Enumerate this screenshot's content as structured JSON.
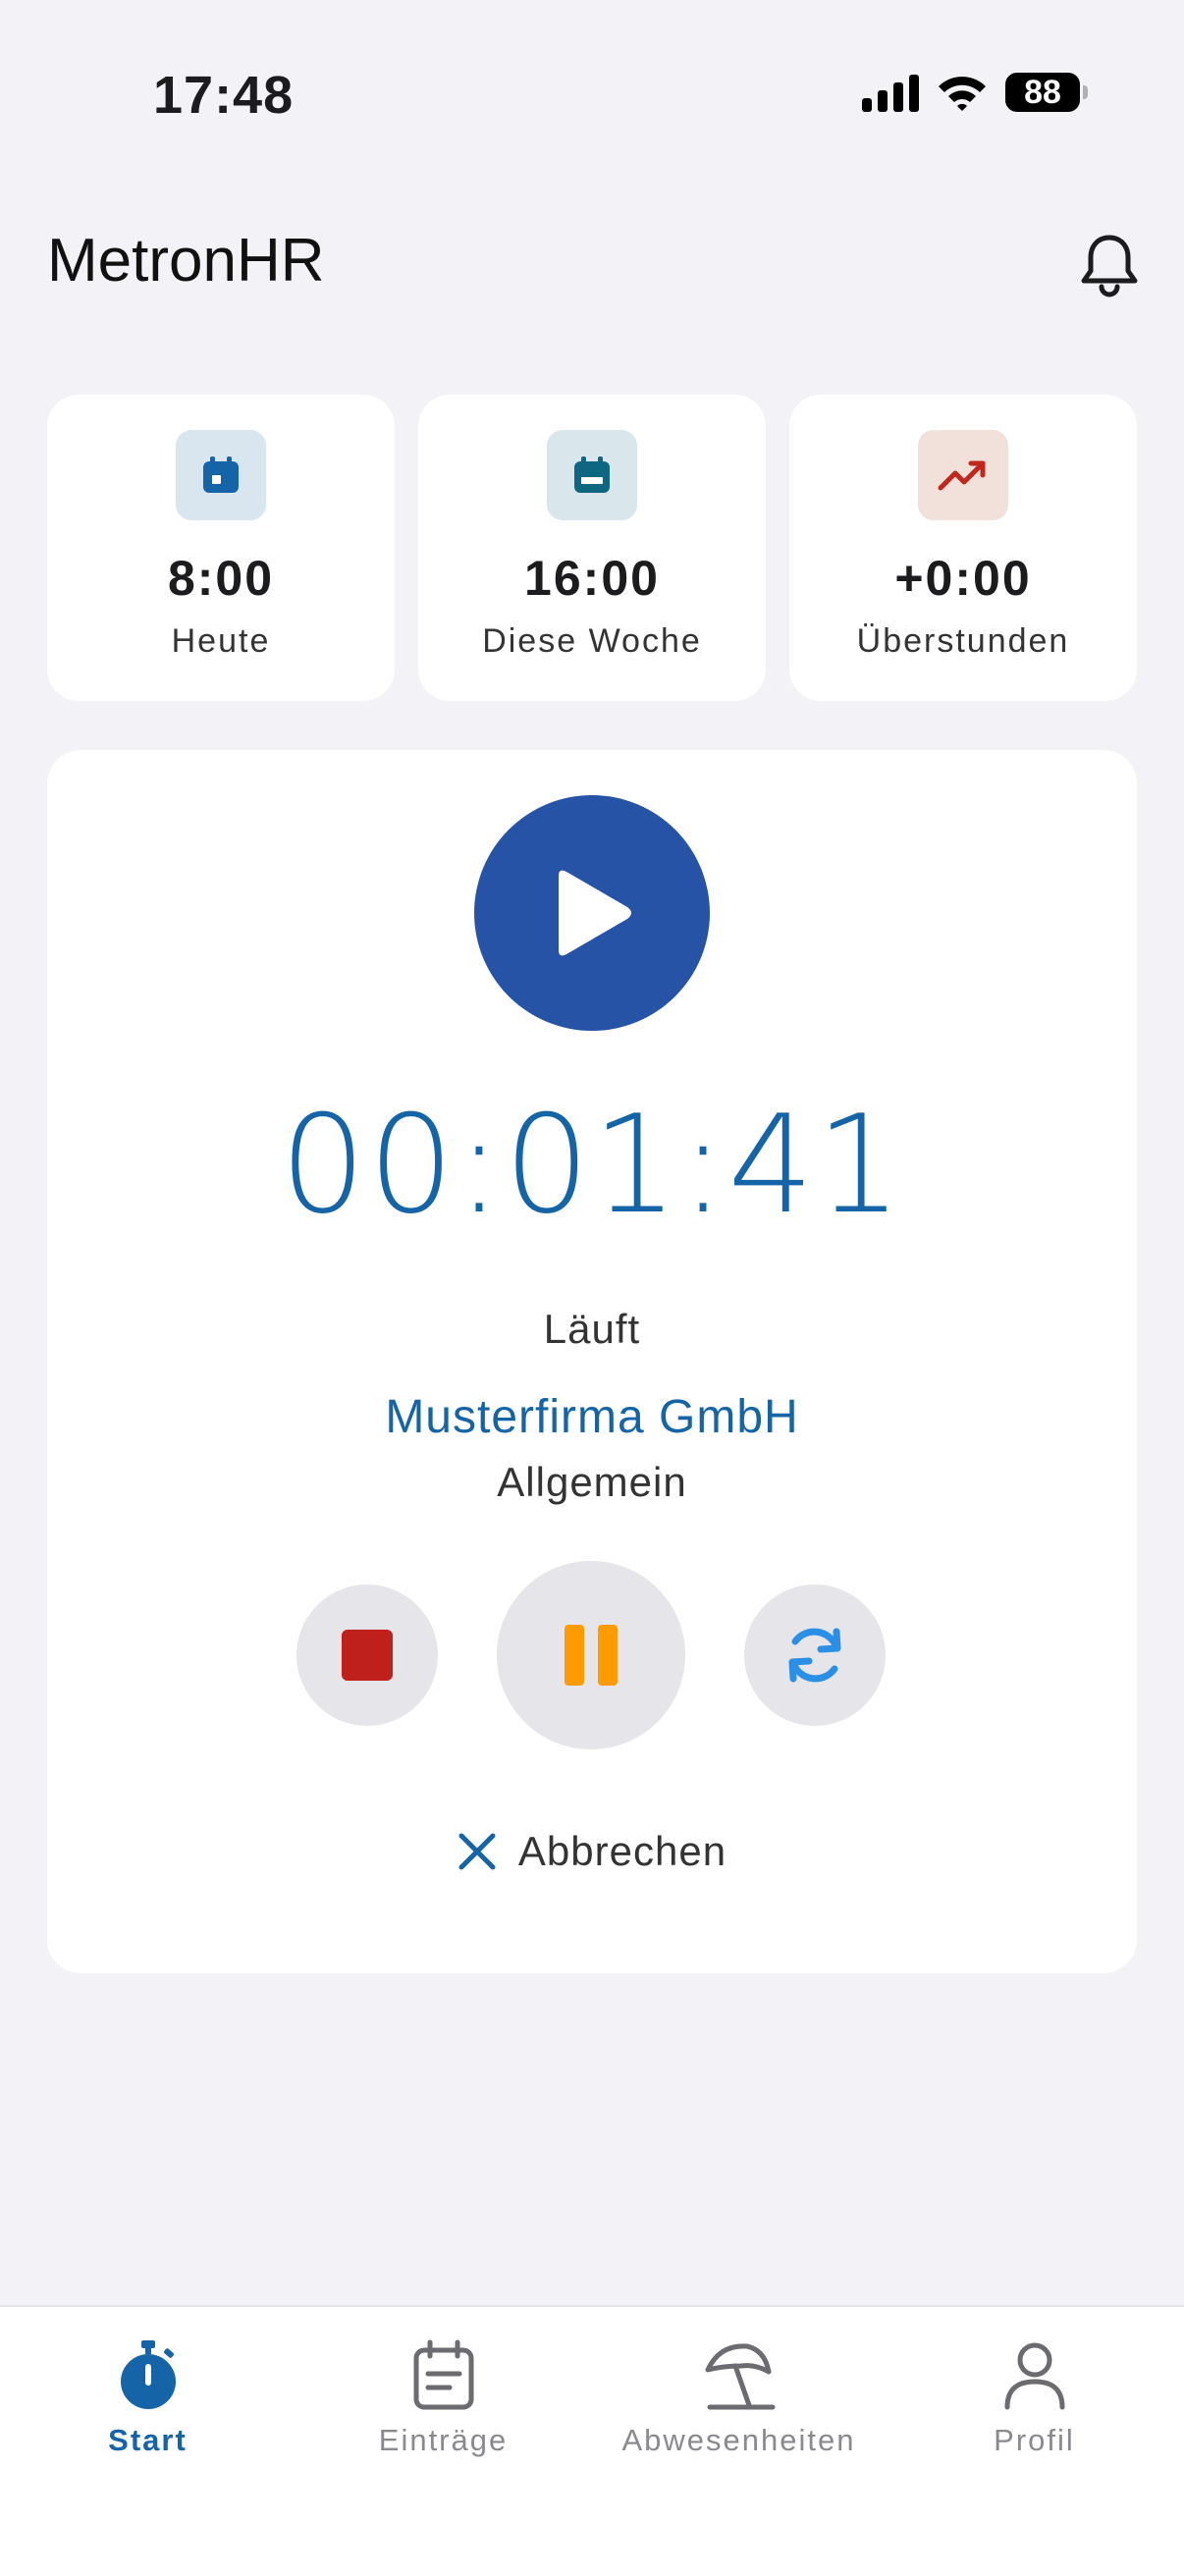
{
  "status_bar": {
    "time": "17:48",
    "battery": "88",
    "icons": [
      "signal-icon",
      "wifi-icon",
      "battery-icon"
    ]
  },
  "header": {
    "title": "MetronHR",
    "bell_icon": "bell-icon"
  },
  "stats": [
    {
      "value": "8:00",
      "label": "Heute",
      "icon": "calendar-icon",
      "icon_bg": "#d9e6f0",
      "icon_color": "#1664a8"
    },
    {
      "value": "16:00",
      "label": "Diese Woche",
      "icon": "calendar-week-icon",
      "icon_bg": "#d9e6ec",
      "icon_color": "#0e6680"
    },
    {
      "value": "+0:00",
      "label": "Überstunden",
      "icon": "trending-up-icon",
      "icon_bg": "#f2e1da",
      "icon_color": "#c0281e"
    }
  ],
  "timer": {
    "elapsed": "00:01:41",
    "status": "Läuft",
    "company": "Musterfirma GmbH",
    "project": "Allgemein",
    "cancel_label": "Abbrechen"
  },
  "colors": {
    "primary": "#2653a5",
    "accent_text": "#1664a8",
    "stop": "#c0201c",
    "pause": "#ff9a00",
    "reset": "#2b8fe6"
  },
  "tabs": [
    {
      "label": "Start",
      "icon": "stopwatch-icon",
      "active": true
    },
    {
      "label": "Einträge",
      "icon": "calendar-list-icon",
      "active": false
    },
    {
      "label": "Abwesenheiten",
      "icon": "beach-umbrella-icon",
      "active": false
    },
    {
      "label": "Profil",
      "icon": "person-icon",
      "active": false
    }
  ]
}
